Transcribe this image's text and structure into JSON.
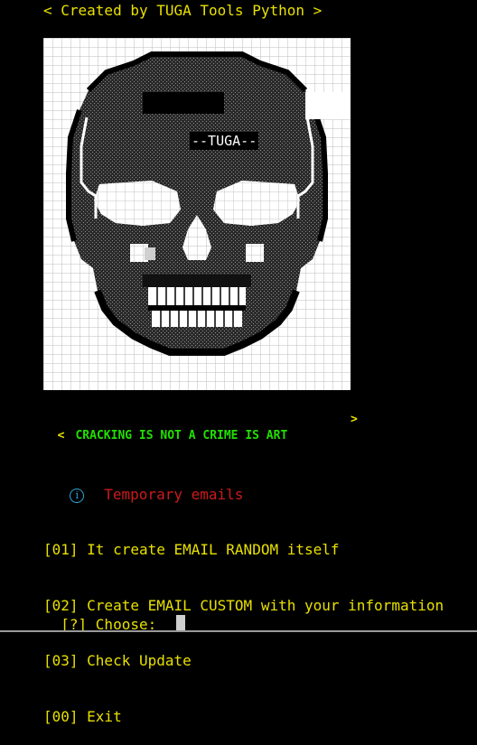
{
  "terminal": {
    "header": "< Created by TUGA Tools Python >",
    "art_label": "--TUGA--",
    "banner_open": "<",
    "banner_text": "CRACKING IS NOT A CRIME IS ART",
    "banner_close": ">",
    "subtitle_icon": "info-icon",
    "subtitle": "Temporary emails",
    "menu": [
      {
        "label": "[01] It create EMAIL RANDOM itself"
      },
      {
        "label": "[02] Create EMAIL CUSTOM with your information"
      },
      {
        "label": "[03] Check Update"
      },
      {
        "label": "[00] Exit"
      }
    ],
    "prompt": "[?] Choose:"
  },
  "colors": {
    "background": "#000000",
    "yellow": "#e8e000",
    "green": "#22e000",
    "red": "#cc1a1a",
    "info_blue": "#2aa8d8"
  }
}
